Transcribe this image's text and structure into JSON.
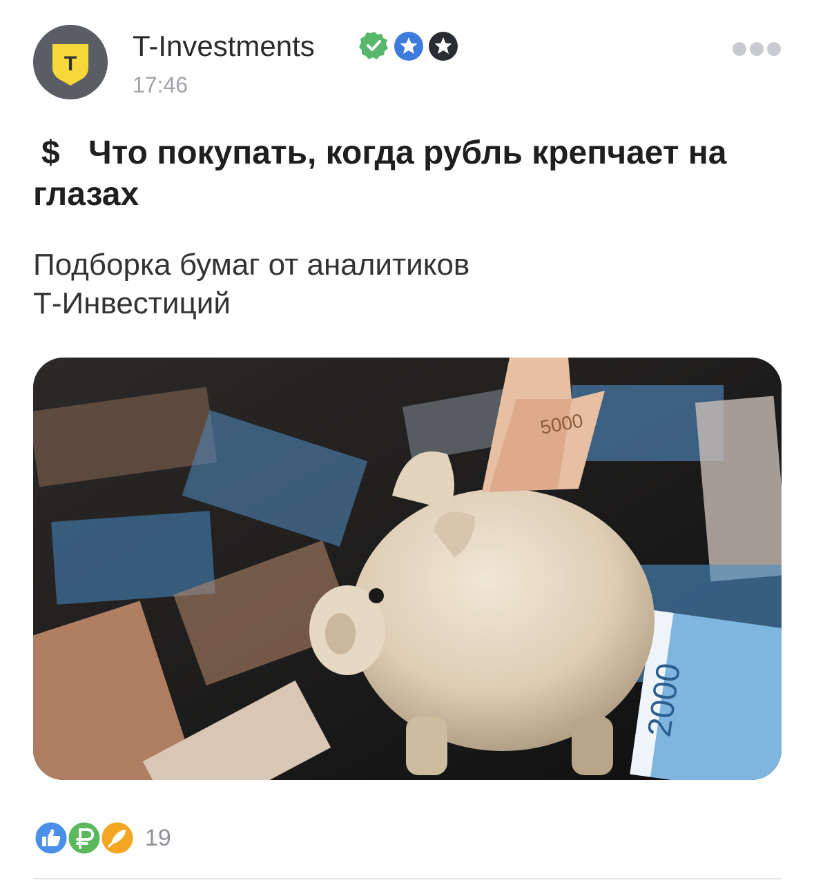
{
  "post": {
    "author": "T-Investments",
    "time": "17:46",
    "title_icon": "$",
    "title": "Что покупать, когда рубль крепчает на глазах",
    "subtitle_lines": [
      "Подборка бумаг от аналитиков",
      "Т-Инвестиций"
    ],
    "avatar_letter": "T",
    "reactions_count": "19",
    "photo_labels": {
      "note_top": "5000",
      "note_right": "2000"
    }
  },
  "badges": [
    "verified-icon",
    "blue-star-icon",
    "dark-star-icon"
  ],
  "reaction_icons": [
    "like-icon",
    "ruble-icon",
    "rocket-icon"
  ],
  "colors": {
    "brand_yellow": "#f6d83a",
    "verified_green": "#57b86b",
    "badge_blue": "#3d7bdc",
    "badge_dark": "#2a2c33",
    "reaction_like": "#4a8fe8",
    "reaction_ruble": "#5cb85c",
    "reaction_rocket": "#f5a623"
  }
}
